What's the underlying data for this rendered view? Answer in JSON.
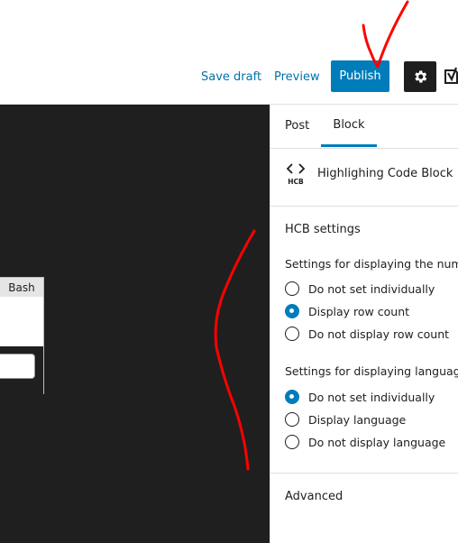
{
  "header": {
    "save_draft_label": "Save draft",
    "preview_label": "Preview",
    "publish_label": "Publish",
    "settings_icon": "gear-icon",
    "plugin_icon": "yoast-icon"
  },
  "editor": {
    "code_language": "Bash"
  },
  "sidebar": {
    "tabs": [
      {
        "label": "Post"
      },
      {
        "label": "Block"
      }
    ],
    "active_tab": "Block",
    "block": {
      "icon": "code-brackets-icon",
      "icon_text": "HCB",
      "title": "Highlighing Code Block"
    },
    "hcb_settings": {
      "title": "HCB settings",
      "row_numbers": {
        "label": "Settings for displaying the numbe",
        "options": [
          "Do not set individually",
          "Display row count",
          "Do not display row count"
        ],
        "selected": "Display row count"
      },
      "language_name": {
        "label": "Settings for displaying language n",
        "options": [
          "Do not set individually",
          "Display language",
          "Do not display language"
        ],
        "selected": "Do not set individually"
      }
    },
    "advanced_title": "Advanced"
  },
  "colors": {
    "accent": "#007cba",
    "link": "#0073aa",
    "dark": "#1e1e1e",
    "annotation": "#ff0000"
  }
}
